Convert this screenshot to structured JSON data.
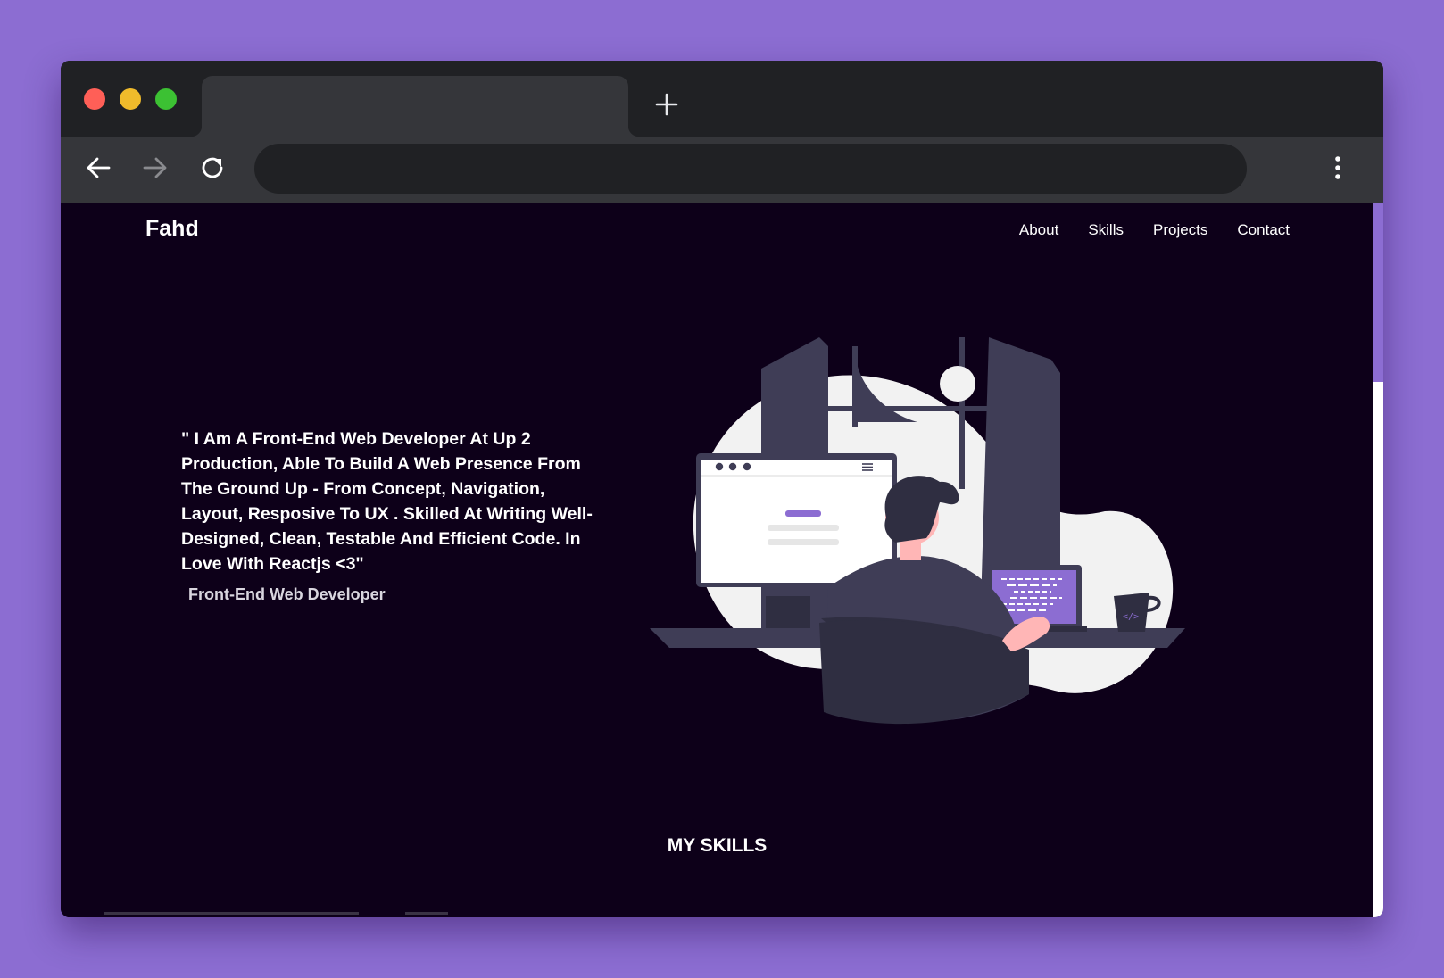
{
  "browser": {
    "tab_title": "",
    "address": ""
  },
  "site": {
    "brand": "Fahd",
    "nav": [
      "About",
      "Skills",
      "Projects",
      "Contact"
    ],
    "hero": {
      "intro": "\" I Am A Front-End Web Developer At Up 2 Production, Able To Build A Web Presence From The Ground Up - From Concept, Navigation, Layout, Resposive To UX . Skilled At Writing Well-Designed, Clean, Testable And Efficient Code. In Love With Reactjs <3\"",
      "role": "Front-End Web Developer"
    },
    "skills_title": "MY SKILLS"
  },
  "colors": {
    "background": "#8c6dd2",
    "page": "#0d0019",
    "accent": "#8c6dd2",
    "chrome_dark": "#202124",
    "chrome_light": "#35363a"
  },
  "icons": {
    "back": "arrow-left-icon",
    "forward": "arrow-right-icon",
    "reload": "reload-icon",
    "new_tab": "plus-icon",
    "menu": "kebab-menu-icon"
  }
}
